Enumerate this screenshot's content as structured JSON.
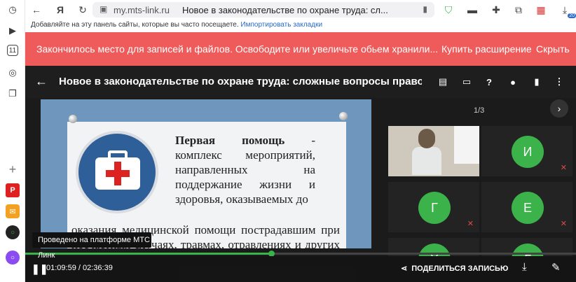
{
  "browser": {
    "url_domain": "my.mts-link.ru",
    "tab_title": "Новое в законодательстве по охране труда: сл...",
    "bookmarks_hint": "Добавляйте на эту панель сайты, которые вы часто посещаете.",
    "bookmarks_import": "Импортировать закладки",
    "badge_count": "20",
    "rail_day": "11"
  },
  "banner": {
    "message": "Закончилось место для записей и файлов. Освободите или увеличьте обьем хранили...",
    "buy_label": "Купить расширение",
    "hide_label": "Скрыть",
    "color": "#ef5b5b"
  },
  "player": {
    "title": "Новое в законодательстве по охране труда: сложные вопросы правопр",
    "tooltip": "Проведено на платформе МТС Линк",
    "current_time": "01:09:59",
    "total_time": "02:36:39",
    "progress": 0.447,
    "share_label": "ПОДЕЛИТЬСЯ ЗАПИСЬЮ",
    "pager": "1/3",
    "accent": "#3bb34a"
  },
  "slide": {
    "term": "Первая помощь",
    "text1": " - комплекс мероприятий, направленных на поддержание жизни и здоровья, оказываемых до",
    "text2": "оказания медицинской помощи пострадавшим при несчастных случаях, травмах, отравлениях и других состояниях, угрожающих их жизни и здоровью"
  },
  "participants": [
    {
      "initial": "И"
    },
    {
      "initial": "Г"
    },
    {
      "initial": "Е"
    },
    {
      "initial": "Х"
    },
    {
      "initial": "Г"
    }
  ]
}
